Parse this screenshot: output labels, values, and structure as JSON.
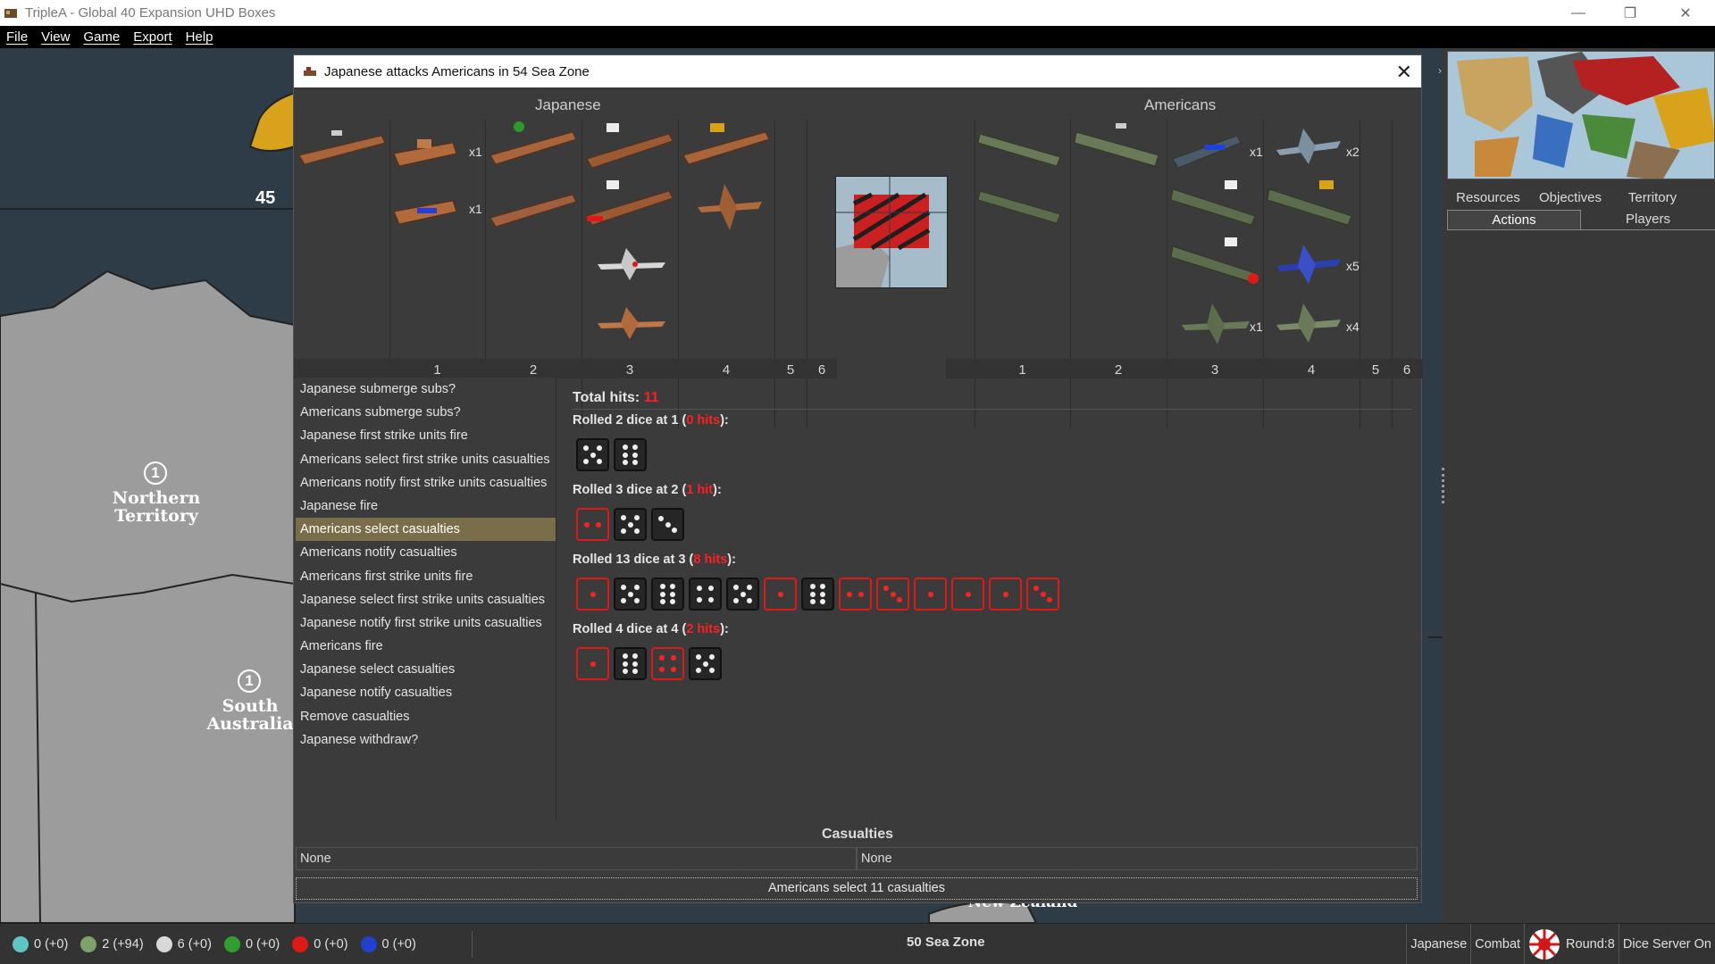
{
  "window": {
    "title": "TripleA - Global 40 Expansion UHD Boxes",
    "minimize": "—",
    "maximize": "❐",
    "close": "✕"
  },
  "menu": [
    "File",
    "View",
    "Game",
    "Export",
    "Help"
  ],
  "map": {
    "seazone_number": "45",
    "territories": [
      {
        "name_line1": "Northern",
        "name_line2": "Territory",
        "value": "1"
      },
      {
        "name_line1": "South",
        "name_line2": "Australia",
        "value": "1"
      }
    ],
    "bottom_label": "New Zealand"
  },
  "right_panel": {
    "tabs_row1": [
      "Resources",
      "Objectives",
      "Territory"
    ],
    "tabs_row2": [
      "Actions",
      "Players"
    ],
    "active_tab": "Actions"
  },
  "dialog": {
    "title": "Japanese attacks Americans in 54 Sea Zone",
    "close": "✕",
    "attacker": "Japanese",
    "defender": "Americans",
    "attacker_columns": [
      "1",
      "2",
      "3",
      "4",
      "5",
      "6"
    ],
    "defender_columns": [
      "1",
      "2",
      "3",
      "4",
      "5",
      "6"
    ],
    "attacker_counts": [
      "x1",
      "x1"
    ],
    "defender_counts": [
      "x1",
      "x2",
      "x5",
      "x1",
      "x4"
    ],
    "steps": [
      "Japanese submerge subs?",
      "Americans submerge subs?",
      "Japanese first strike units fire",
      "Americans select first strike units casualties",
      "Americans notify first strike units casualties",
      "Japanese fire",
      "Americans select casualties",
      "Americans notify casualties",
      "Americans first strike units fire",
      "Japanese select first strike units casualties",
      "Japanese notify first strike units casualties",
      "Americans fire",
      "Japanese select casualties",
      "Japanese notify casualties",
      "Remove casualties",
      "Japanese withdraw?"
    ],
    "active_step": "Americans select casualties",
    "total_hits_label": "Total hits:",
    "total_hits_value": "11",
    "rolls": [
      {
        "prefix": "Rolled 2 dice at 1 (",
        "hits": "0 hits",
        "suffix": "):",
        "dice": [
          5,
          6
        ],
        "hit": [
          false,
          false
        ]
      },
      {
        "prefix": "Rolled 3 dice at 2 (",
        "hits": "1 hit",
        "suffix": "):",
        "dice": [
          2,
          5,
          3
        ],
        "hit": [
          true,
          false,
          false
        ]
      },
      {
        "prefix": "Rolled 13 dice at 3 (",
        "hits": "8 hits",
        "suffix": "):",
        "dice": [
          1,
          5,
          6,
          4,
          5,
          1,
          6,
          2,
          3,
          1,
          1,
          1,
          3
        ],
        "hit": [
          true,
          false,
          false,
          false,
          false,
          true,
          false,
          true,
          true,
          true,
          true,
          true,
          true
        ]
      },
      {
        "prefix": "Rolled 4 dice at 4 (",
        "hits": "2 hits",
        "suffix": "):",
        "dice": [
          1,
          6,
          4,
          5
        ],
        "hit": [
          true,
          false,
          true,
          false
        ]
      }
    ],
    "casualties_title": "Casualties",
    "casualties_left": "None",
    "casualties_right": "None",
    "select_bar": "Americans select 11 casualties"
  },
  "status": {
    "items": [
      {
        "icon": "flask-icon",
        "value": "0 (+0)",
        "color": "#5fc4c4"
      },
      {
        "icon": "money-icon",
        "value": "2 (+94)",
        "color": "#7da36a"
      },
      {
        "icon": "skull-icon",
        "value": "6 (+0)",
        "color": "#d8d8d8"
      },
      {
        "icon": "frog-icon",
        "value": "0 (+0)",
        "color": "#2fa02f"
      },
      {
        "icon": "red-token-icon",
        "value": "0 (+0)",
        "color": "#e01818"
      },
      {
        "icon": "blue-token-icon",
        "value": "0 (+0)",
        "color": "#2040d0"
      }
    ],
    "territory": "50 Sea Zone",
    "player": "Japanese",
    "phase": "Combat",
    "round": "Round:8",
    "dice_server": "Dice Server On"
  }
}
